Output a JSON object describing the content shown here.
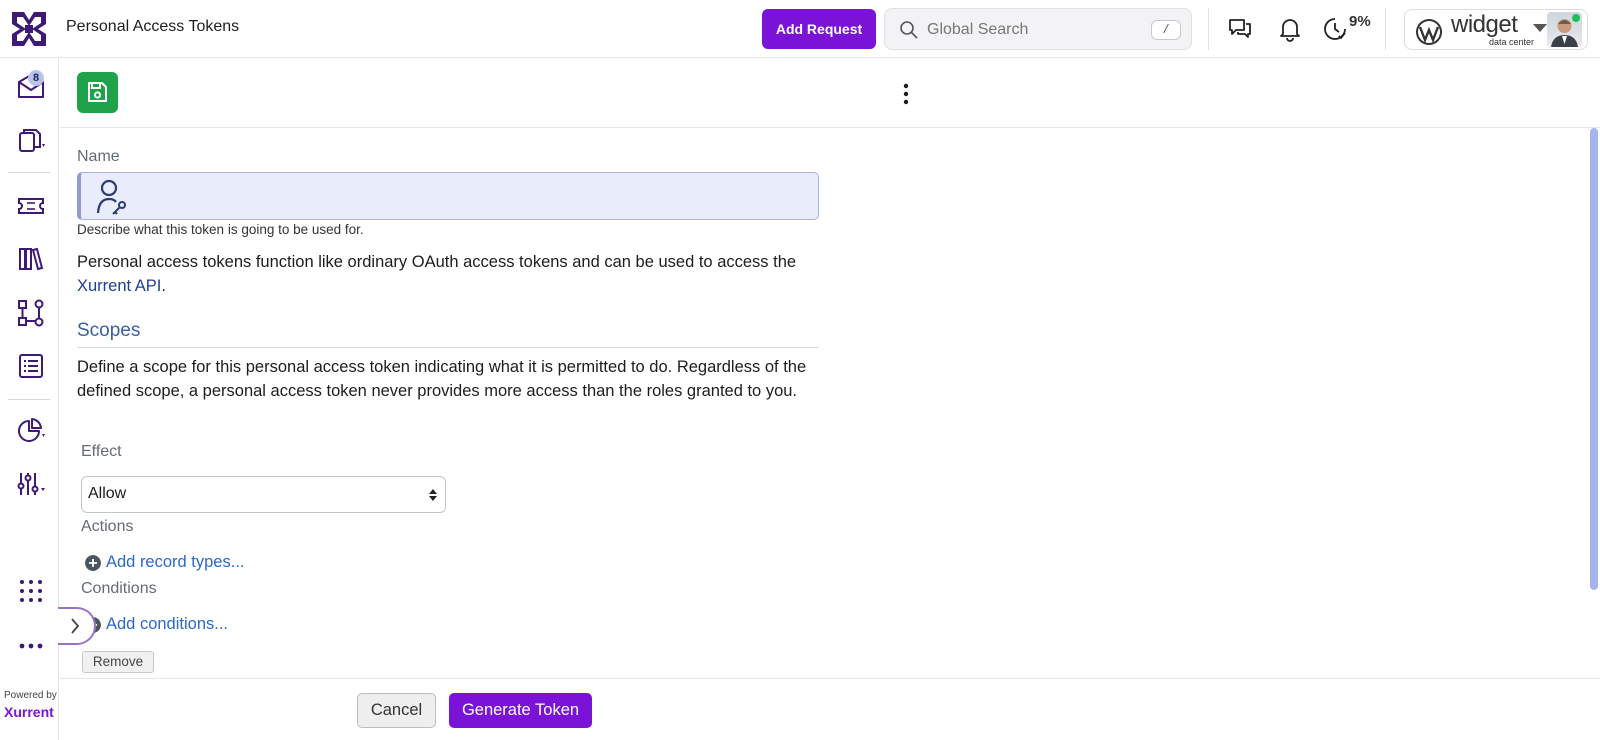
{
  "header": {
    "page_title": "Personal Access Tokens",
    "add_request_label": "Add Request",
    "search_placeholder": "Global Search",
    "search_shortcut": "/",
    "time_percent": "9%",
    "account_brand": "widget",
    "account_sub": "data center"
  },
  "sidenav": {
    "inbox_badge": "8",
    "powered_by": "Powered by",
    "powered_brand": "Xurrent"
  },
  "form": {
    "name_label": "Name",
    "name_value": "",
    "name_help": "Describe what this token is going to be used for.",
    "intro_text": "Personal access tokens function like ordinary OAuth access tokens and can be used to access the ",
    "intro_link": "Xurrent API",
    "intro_end": ".",
    "scopes_title": "Scopes",
    "scopes_desc": "Define a scope for this personal access token indicating what it is permitted to do. Regardless of the defined scope, a personal access token never provides more access than the roles granted to you.",
    "effect_label": "Effect",
    "effect_value": "Allow",
    "actions_label": "Actions",
    "add_record_types": "Add record types...",
    "conditions_label": "Conditions",
    "add_conditions": "Add conditions...",
    "remove_label": "Remove"
  },
  "footer": {
    "cancel_label": "Cancel",
    "generate_label": "Generate Token"
  },
  "colors": {
    "accent": "#7b12d8",
    "save_green": "#1fa34a",
    "link_blue": "#2b67cf",
    "section_blue": "#3a5fa8"
  },
  "icons": {
    "logo": "xurrent-logo-icon",
    "save": "save-icon",
    "search": "search-icon",
    "chat": "chat-icon",
    "bell": "bell-icon",
    "clock": "time-tracking-icon"
  }
}
